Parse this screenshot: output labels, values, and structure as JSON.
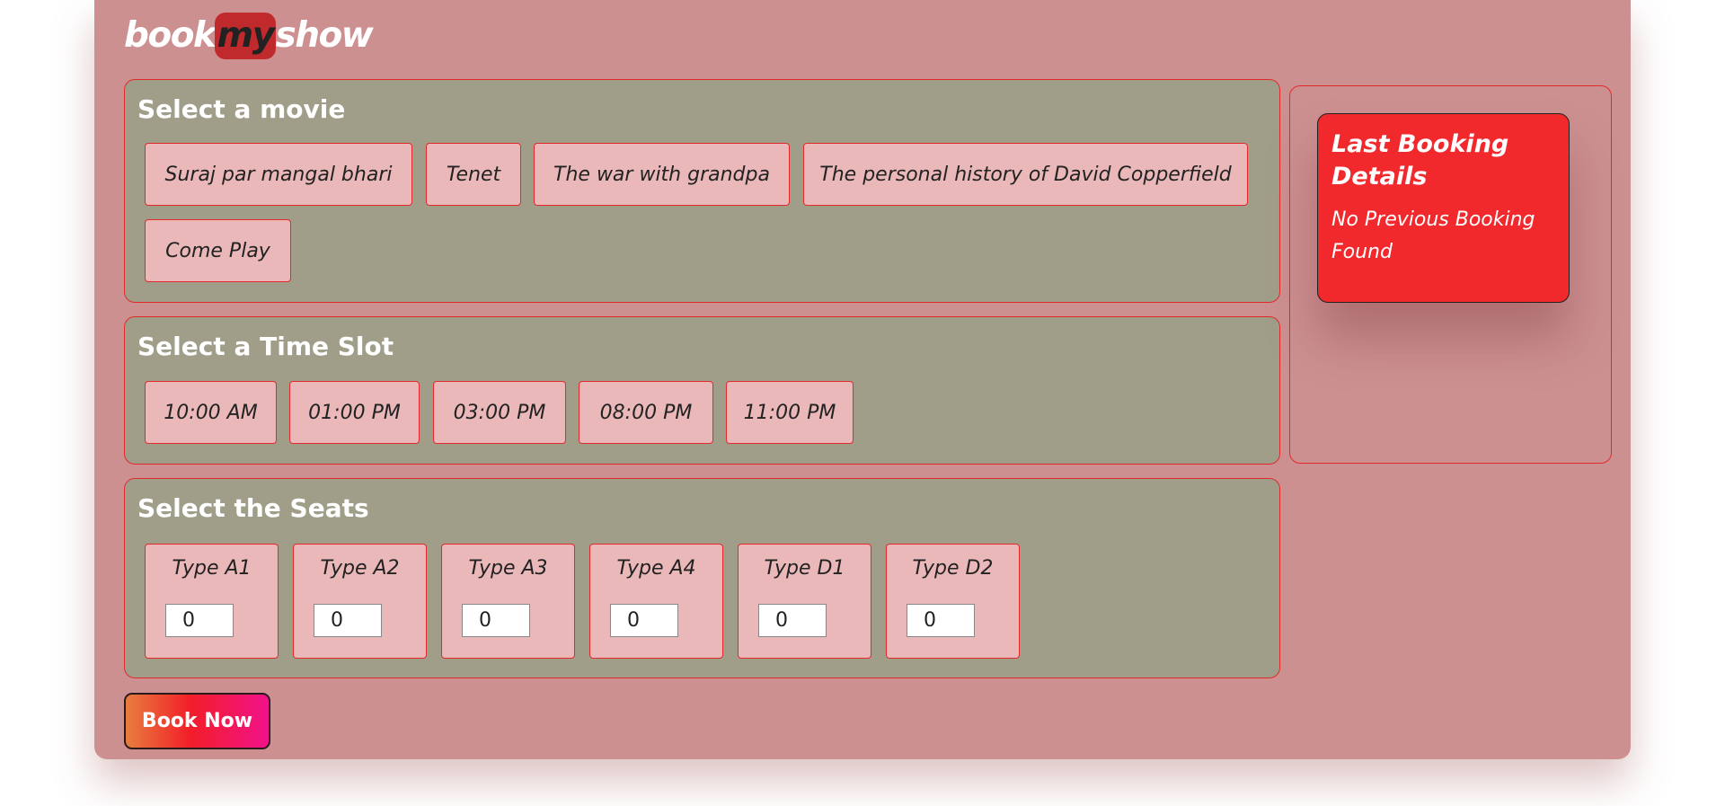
{
  "logo": {
    "book": "book",
    "my": "my",
    "show": "show"
  },
  "movies": {
    "title": "Select a movie",
    "items": [
      "Suraj par mangal bhari",
      "Tenet",
      "The war with grandpa",
      "The personal history of David Copperfield",
      "Come Play"
    ]
  },
  "slots": {
    "title": "Select a Time Slot",
    "items": [
      "10:00 AM",
      "01:00 PM",
      "03:00 PM",
      "08:00 PM",
      "11:00 PM"
    ]
  },
  "seats": {
    "title": "Select the Seats",
    "items": [
      {
        "label": "Type A1",
        "value": "0"
      },
      {
        "label": "Type A2",
        "value": "0"
      },
      {
        "label": "Type A3",
        "value": "0"
      },
      {
        "label": "Type A4",
        "value": "0"
      },
      {
        "label": "Type D1",
        "value": "0"
      },
      {
        "label": "Type D2",
        "value": "0"
      }
    ]
  },
  "last_booking": {
    "title": "Last Booking Details",
    "message": "No Previous Booking Found"
  },
  "book_button": "Book Now",
  "colors": {
    "background": "#cd9091",
    "panel": "#a09e89",
    "chip": "#ebb8b9",
    "accent_border": "#e4292d",
    "booking_card": "#f1282c"
  }
}
